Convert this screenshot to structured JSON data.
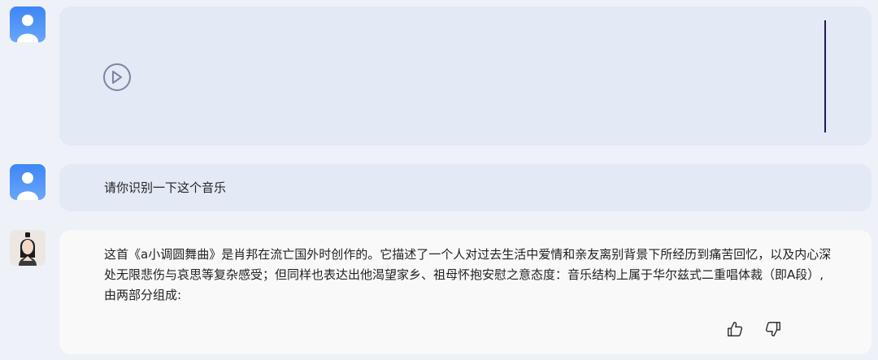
{
  "conversation": {
    "audio_message": {
      "play_icon": "play-circle-icon"
    },
    "user_message": {
      "text": "请你识别一下这个音乐"
    },
    "assistant_message": {
      "text": "这首《a小调圆舞曲》是肖邦在流亡国外时创作的。它描述了一个人对过去生活中爱情和亲友离别背景下所经历到痛苦回忆，以及内心深处无限悲伤与哀思等复杂感受；但同样也表达出他渴望家乡、祖母怀抱安慰之意态度：音乐结构上属于华尔兹式二重唱体裁（即A段）,由两部分组成:",
      "actions": {
        "like_icon": "thumbs-up-icon",
        "dislike_icon": "thumbs-down-icon"
      }
    }
  },
  "colors": {
    "page_bg": "#eef1f8",
    "user_bubble": "#e3e9f5",
    "assistant_bubble": "#f9f9fa",
    "avatar_blue": "#3d86f5"
  }
}
